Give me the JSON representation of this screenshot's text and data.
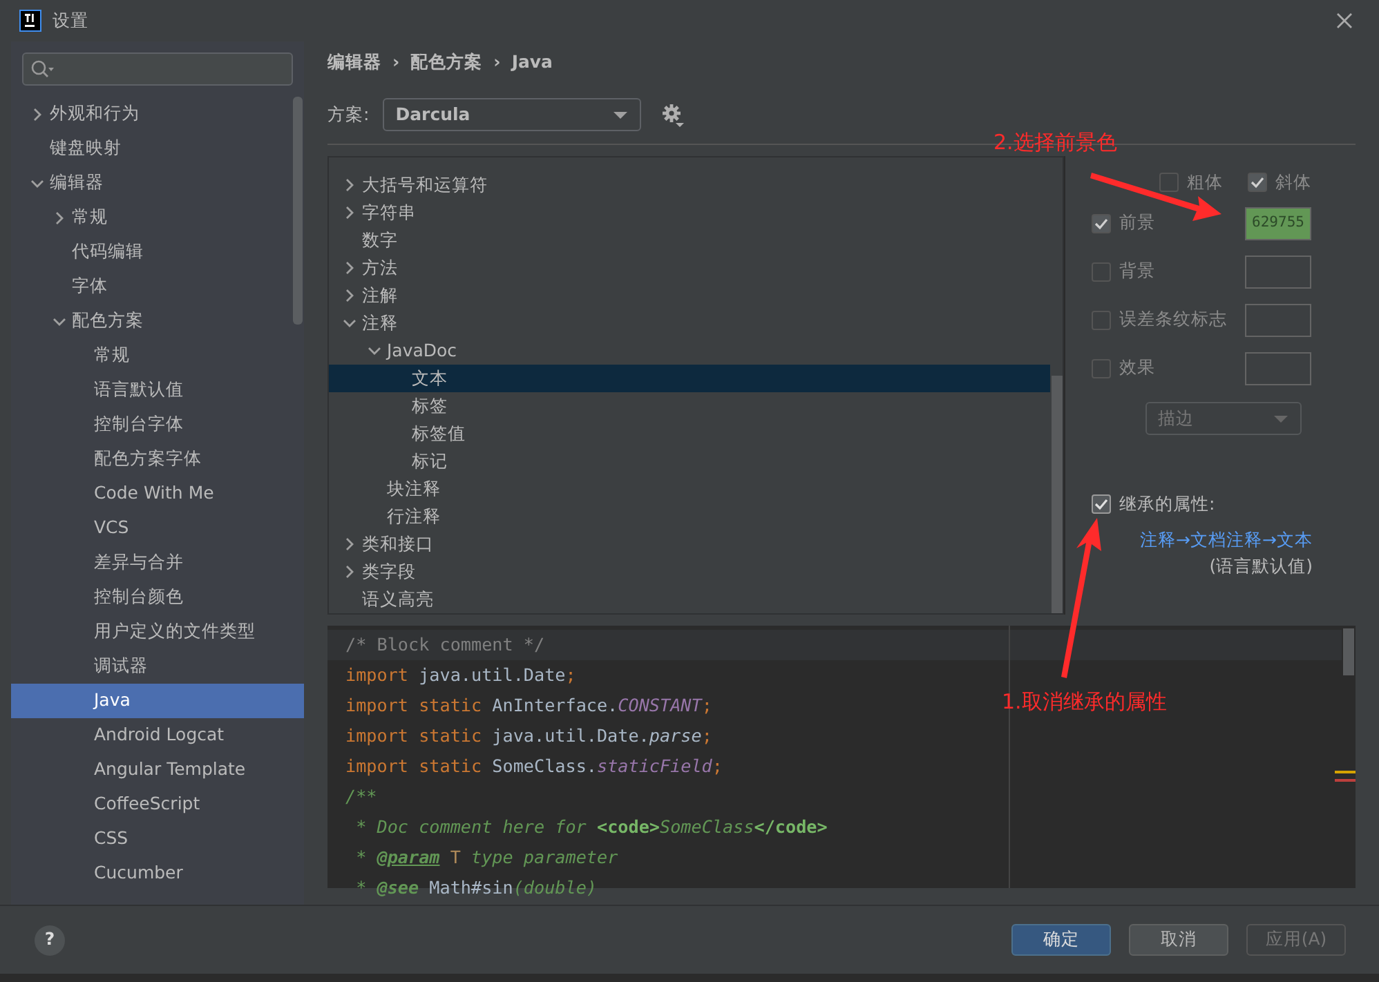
{
  "window": {
    "title": "设置"
  },
  "sidebar": {
    "items": [
      {
        "label": "外观和行为",
        "expanded": false,
        "selected": false
      },
      {
        "label": "键盘映射",
        "selected": false
      },
      {
        "label": "编辑器",
        "expanded": true,
        "selected": false,
        "children": [
          {
            "label": "常规",
            "expanded": false,
            "selected": false
          },
          {
            "label": "代码编辑",
            "selected": false
          },
          {
            "label": "字体",
            "selected": false
          },
          {
            "label": "配色方案",
            "expanded": true,
            "selected": false,
            "children": [
              {
                "label": "常规",
                "selected": false
              },
              {
                "label": "语言默认值",
                "selected": false
              },
              {
                "label": "控制台字体",
                "selected": false
              },
              {
                "label": "配色方案字体",
                "selected": false
              },
              {
                "label": "Code With Me",
                "selected": false
              },
              {
                "label": "VCS",
                "selected": false
              },
              {
                "label": "差异与合并",
                "selected": false
              },
              {
                "label": "控制台颜色",
                "selected": false
              },
              {
                "label": "用户定义的文件类型",
                "selected": false
              },
              {
                "label": "调试器",
                "selected": false
              },
              {
                "label": "Java",
                "selected": true
              },
              {
                "label": "Android Logcat",
                "selected": false
              },
              {
                "label": "Angular Template",
                "selected": false
              },
              {
                "label": "CoffeeScript",
                "selected": false
              },
              {
                "label": "CSS",
                "selected": false
              },
              {
                "label": "Cucumber",
                "selected": false
              }
            ]
          }
        ]
      }
    ]
  },
  "breadcrumb": [
    "编辑器",
    "›",
    "配色方案",
    "›",
    "Java"
  ],
  "scheme": {
    "label": "方案:",
    "value": "Darcula"
  },
  "tree": [
    {
      "label": "大括号和运算符",
      "expanded": false,
      "selected": false
    },
    {
      "label": "字符串",
      "expanded": false,
      "selected": false
    },
    {
      "label": "数字",
      "selected": false
    },
    {
      "label": "方法",
      "expanded": false,
      "selected": false
    },
    {
      "label": "注解",
      "expanded": false,
      "selected": false
    },
    {
      "label": "注释",
      "expanded": true,
      "selected": false,
      "children": [
        {
          "label": "JavaDoc",
          "expanded": true,
          "selected": false,
          "children": [
            {
              "label": "文本",
              "selected": true
            },
            {
              "label": "标签",
              "selected": false
            },
            {
              "label": "标签值",
              "selected": false
            },
            {
              "label": "标记",
              "selected": false
            }
          ]
        },
        {
          "label": "块注释",
          "selected": false
        },
        {
          "label": "行注释",
          "selected": false
        }
      ]
    },
    {
      "label": "类和接口",
      "expanded": false,
      "selected": false
    },
    {
      "label": "类字段",
      "expanded": false,
      "selected": false
    },
    {
      "label": "语义高亮",
      "selected": false
    }
  ],
  "attributes": {
    "styles": [
      {
        "label": "粗体",
        "checked": false,
        "disabled": true
      },
      {
        "label": "斜体",
        "checked": true,
        "disabled": true
      }
    ],
    "colors": [
      {
        "label": "前景",
        "checked": true,
        "disabled": true,
        "value": "629755",
        "color": "#629755"
      },
      {
        "label": "背景",
        "checked": false,
        "disabled": true
      },
      {
        "label": "误差条纹标志",
        "checked": false,
        "disabled": true
      },
      {
        "label": "效果",
        "checked": false,
        "disabled": true
      }
    ],
    "effect_style": {
      "value": "描边",
      "disabled": true
    },
    "inherit": {
      "label": "继承的属性:",
      "checked": true,
      "disabled": false
    },
    "inherit_link": "注释→文档注释→文本",
    "inherit_note": "(语言默认值)"
  },
  "preview": {
    "lines": [
      [
        {
          "kind": "comment",
          "text": "/* Block comment */"
        }
      ],
      [
        {
          "kind": "keyword",
          "text": "import "
        },
        {
          "kind": "plain",
          "text": "java.util.Date"
        },
        {
          "kind": "keyword",
          "text": ";"
        }
      ],
      [
        {
          "kind": "keyword",
          "text": "import static "
        },
        {
          "kind": "plain",
          "text": "AnInterface."
        },
        {
          "kind": "constant",
          "text": "CONSTANT"
        },
        {
          "kind": "keyword",
          "text": ";"
        }
      ],
      [
        {
          "kind": "keyword",
          "text": "import static "
        },
        {
          "kind": "plain",
          "text": "java.util.Date."
        },
        {
          "kind": "method",
          "text": "parse"
        },
        {
          "kind": "keyword",
          "text": ";"
        }
      ],
      [
        {
          "kind": "keyword",
          "text": "import static "
        },
        {
          "kind": "plain",
          "text": "SomeClass."
        },
        {
          "kind": "constant",
          "text": "staticField"
        },
        {
          "kind": "keyword",
          "text": ";"
        }
      ],
      [
        {
          "kind": "doc",
          "text": "/**"
        }
      ],
      [
        {
          "kind": "doc",
          "text": " * Doc comment here for "
        },
        {
          "kind": "docmarkup",
          "text": "<code>"
        },
        {
          "kind": "doc",
          "text": "SomeClass"
        },
        {
          "kind": "docmarkup",
          "text": "</code>"
        }
      ],
      [
        {
          "kind": "doc",
          "text": " * "
        },
        {
          "kind": "doctag",
          "text": "@param"
        },
        {
          "kind": "typeparam",
          "text": " T"
        },
        {
          "kind": "doc",
          "text": " type parameter"
        }
      ],
      [
        {
          "kind": "doc",
          "text": " * "
        },
        {
          "kind": "doctagplain",
          "text": "@see"
        },
        {
          "kind": "plain",
          "text": " Math#sin"
        },
        {
          "kind": "doc",
          "text": "(double)"
        }
      ]
    ]
  },
  "annotations": [
    {
      "text": "2.选择前景色"
    },
    {
      "text": "1.取消继承的属性"
    }
  ],
  "footer": {
    "help": "?",
    "buttons": [
      {
        "label": "确定",
        "kind": "primary",
        "disabled": false
      },
      {
        "label": "取消",
        "kind": "secondary",
        "disabled": false
      },
      {
        "label": "应用(A)",
        "kind": "secondary",
        "disabled": true
      }
    ]
  }
}
